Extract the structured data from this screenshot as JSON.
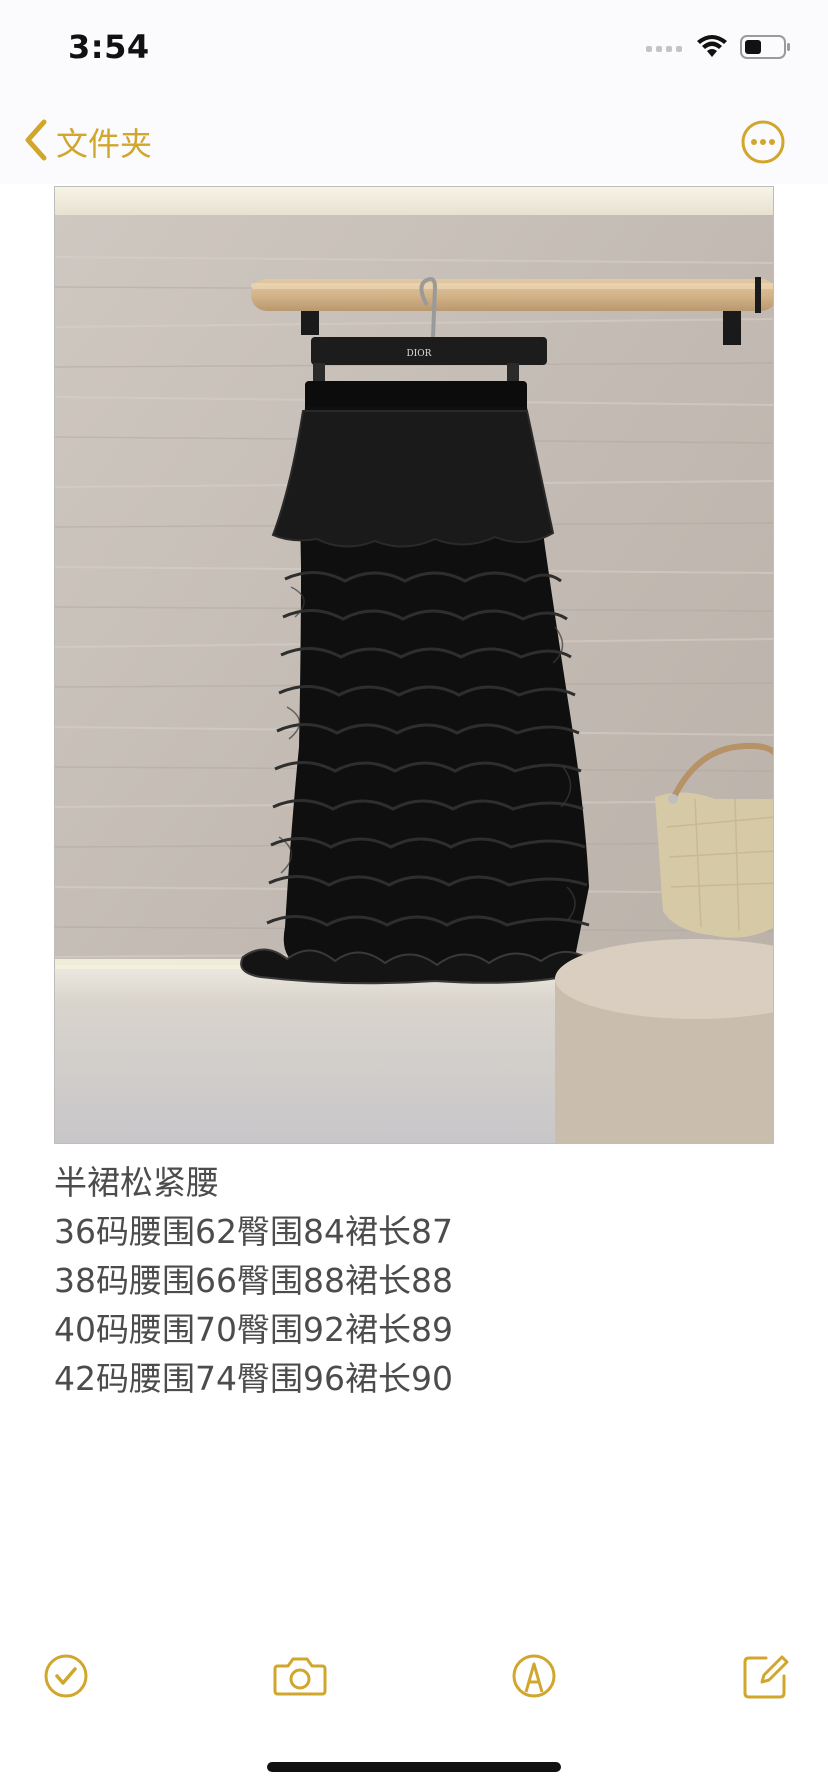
{
  "status_bar": {
    "time": "3:54",
    "icons": [
      "signal-icon",
      "wifi-icon",
      "battery-icon"
    ]
  },
  "nav": {
    "back_label": "文件夹",
    "back_icon": "chevron-left-icon",
    "more_icon": "ellipsis-circle-icon"
  },
  "photo": {
    "hanger_label": "DIOR"
  },
  "note": {
    "lines": [
      "半裙松紧腰",
      "36码腰围62臀围84裙长87",
      "38码腰围66臀围88裙长88",
      "40码腰围70臀围92裙长89",
      "42码腰围74臀围96裙长90"
    ]
  },
  "toolbar": {
    "icons": [
      "checklist-icon",
      "camera-icon",
      "markup-pen-icon",
      "compose-icon"
    ]
  },
  "colors": {
    "accent": "#d1a62c",
    "text": "#4c4c4c",
    "background": "#ffffff"
  }
}
